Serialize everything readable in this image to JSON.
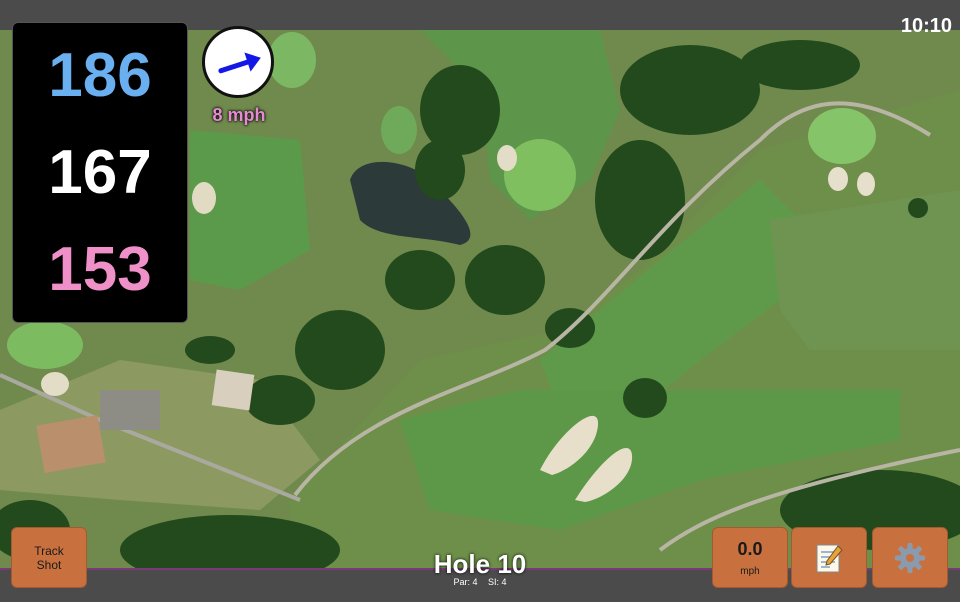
{
  "status": {
    "time": "10:10"
  },
  "distances": {
    "back": "186",
    "middle": "167",
    "front": "153",
    "colors": {
      "back": "#6ab0f0",
      "middle": "#ffffff",
      "front": "#f090c8"
    }
  },
  "wind": {
    "speed_label": "8 mph",
    "direction_icon": "arrow-icon",
    "arrow_color": "#1418e6"
  },
  "hole": {
    "title": "Hole 10",
    "par": "Par: 4",
    "si": "SI: 4"
  },
  "buttons": {
    "track_shot_line1": "Track",
    "track_shot_line2": "Shot",
    "speed_value": "0.0",
    "speed_unit": "mph",
    "notes_icon": "notepad-icon",
    "settings_icon": "gear-icon",
    "accent": "#c8713f"
  }
}
